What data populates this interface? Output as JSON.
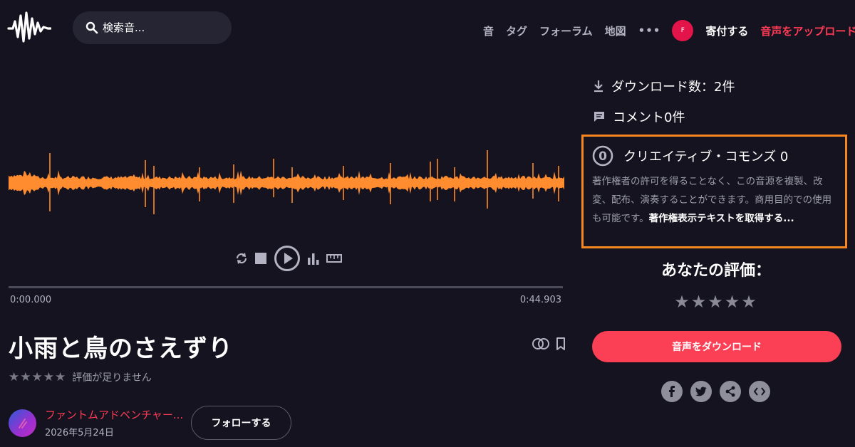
{
  "header": {
    "search_placeholder": "検索音...",
    "nav": [
      "音",
      "タグ",
      "フォーラム",
      "地図"
    ],
    "more": "•••",
    "user_initial": "F",
    "donate": "寄付する",
    "upload": "音声をアップロード"
  },
  "player": {
    "waveform_color": "#ff8c2e",
    "time_start": "0:00.000",
    "time_end": "0:44.903"
  },
  "sound": {
    "title": "小雨と鳥のさえずり",
    "rating_stars": "★★★★★",
    "rating_text": "評価が足りません",
    "author": "ファントムアドベンチャー...",
    "date": "2026年5月24日",
    "follow": "フォローする"
  },
  "sidebar": {
    "downloads": "ダウンロード数：2件",
    "comments": "コメント0件",
    "license": {
      "badge": "0",
      "title": "クリエイティブ・コモンズ 0",
      "description": "著作権者の許可を得ることなく、この音源を複製、改変、配布、演奏することができます。商用目的での使用も可能です。",
      "link": "著作権表示テキストを取得する..."
    },
    "your_rating_title": "あなたの評価：",
    "your_rating_stars": "★★★★★",
    "download_button": "音声をダウンロード"
  },
  "colors": {
    "background": "#14131f",
    "accent": "#fb3f55",
    "highlight_border": "#f6861f",
    "waveform": "#ff8c2e"
  },
  "icons": [
    "logo-waveform-icon",
    "search-icon",
    "loop-icon",
    "stop-icon",
    "play-icon",
    "spectrogram-icon",
    "ruler-icon",
    "compare-icon",
    "bookmark-icon",
    "download-icon",
    "comment-icon",
    "cc-zero-icon",
    "facebook-icon",
    "twitter-icon",
    "share-icon",
    "embed-icon"
  ]
}
